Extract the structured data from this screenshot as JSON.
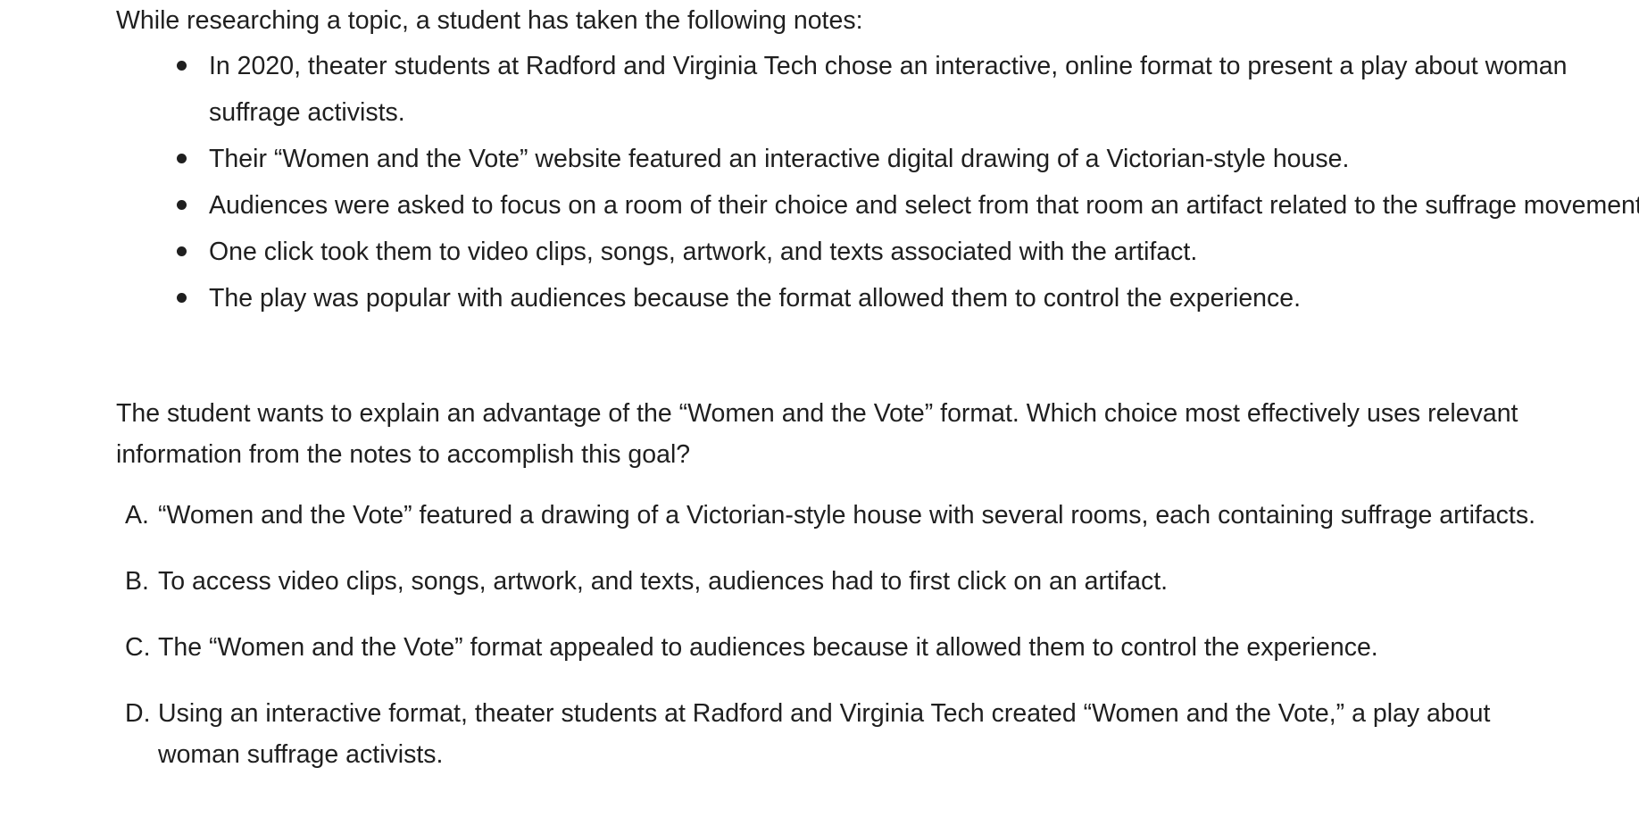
{
  "intro": "While researching a topic, a student has taken the following notes:",
  "notes": [
    "In 2020, theater students at Radford and Virginia Tech chose an interactive, online format to present a play about woman suffrage activists.",
    "Their “Women and the Vote” website featured an interactive digital drawing of a Victorian-style house.",
    "Audiences were asked to focus on a room of their choice and select from that room an artifact related to the suffrage movement.",
    "One click took them to video clips, songs, artwork, and texts associated with the artifact.",
    "The play was popular with audiences because the format allowed them to control the experience."
  ],
  "question": "The student wants to explain an advantage of the “Women and the Vote” format. Which choice most effectively uses relevant information from the notes to accomplish this goal?",
  "choices": [
    {
      "letter": "A.",
      "text": "“Women and the Vote” featured a drawing of a Victorian-style house with several rooms, each containing suffrage artifacts."
    },
    {
      "letter": "B.",
      "text": "To access video clips, songs, artwork, and texts, audiences had to first click on an artifact."
    },
    {
      "letter": "C.",
      "text": "The “Women and the Vote” format appealed to audiences because it allowed them to control the experience."
    },
    {
      "letter": "D.",
      "text": "Using an interactive format, theater students at Radford and Virginia Tech created “Women and the Vote,” a play about woman suffrage activists."
    }
  ]
}
